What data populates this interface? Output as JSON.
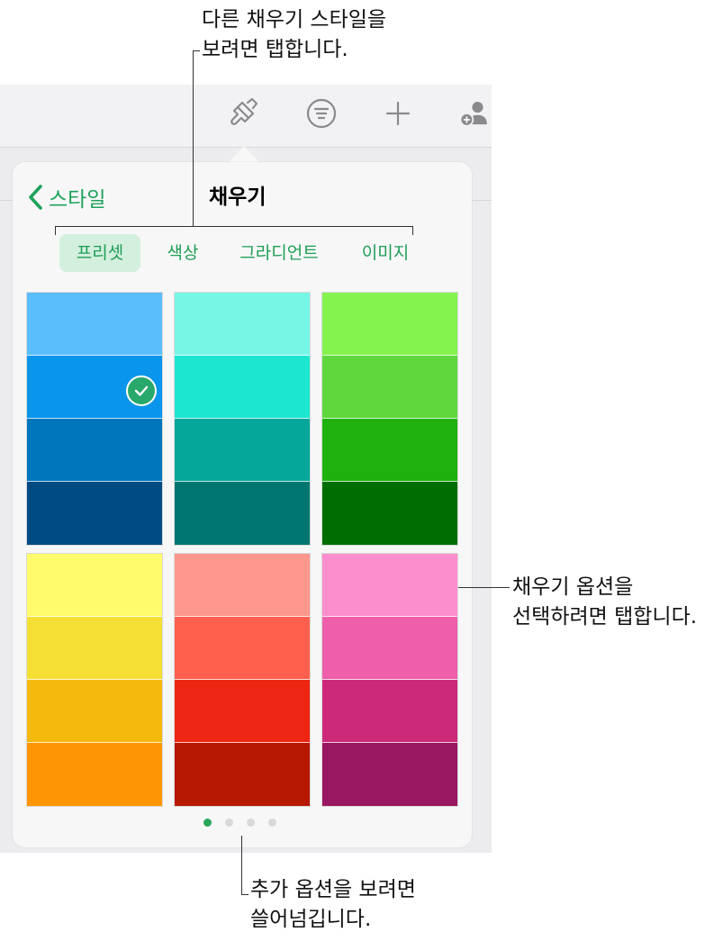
{
  "callouts": {
    "top_line1": "다른 채우기 스타일을",
    "top_line2": "보려면 탭합니다.",
    "right_line1": "채우기 옵션을",
    "right_line2": "선택하려면 탭합니다.",
    "bottom_line1": "추가 옵션을 보려면",
    "bottom_line2": "쓸어넘깁니다."
  },
  "toolbar": {
    "icons": [
      "paintbrush-icon",
      "format-list-icon",
      "plus-icon",
      "add-collaborator-icon"
    ]
  },
  "popover": {
    "back_label": "스타일",
    "title": "채우기",
    "tabs": [
      {
        "label": "프리셋",
        "active": true
      },
      {
        "label": "색상",
        "active": false
      },
      {
        "label": "그라디언트",
        "active": false
      },
      {
        "label": "이미지",
        "active": false
      }
    ],
    "selected_swatch": "blue-2"
  },
  "swatches": {
    "blue": [
      "#5bbefc",
      "#0a95ec",
      "#0076bd",
      "#004b84"
    ],
    "teal": [
      "#77f6e6",
      "#1de6cf",
      "#05a79a",
      "#007671"
    ],
    "green": [
      "#85f34e",
      "#5fd73d",
      "#1fb20d",
      "#006d03"
    ],
    "yellow": [
      "#fffb6a",
      "#f6df35",
      "#f5b80d",
      "#fe9505"
    ],
    "red": [
      "#fe978b",
      "#fe604d",
      "#ed2513",
      "#b71802"
    ],
    "pink": [
      "#fd8ecd",
      "#ef5eaa",
      "#cc2979",
      "#991660"
    ]
  },
  "pagination": {
    "count": 4,
    "active_index": 0
  },
  "accent_color": "#1fa25a"
}
